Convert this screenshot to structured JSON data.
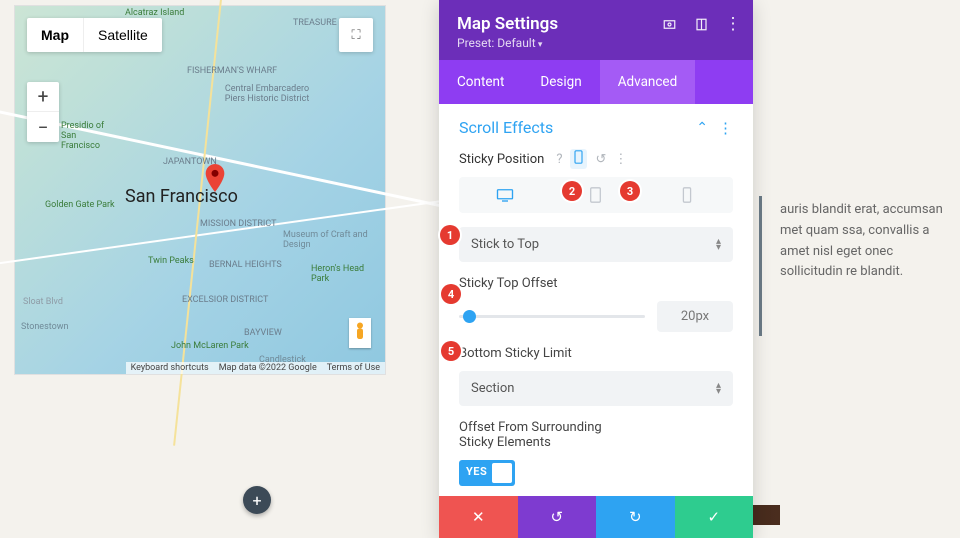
{
  "map": {
    "tab_map": "Map",
    "tab_satellite": "Satellite",
    "city_label": "San Francisco",
    "footer_shortcuts": "Keyboard shortcuts",
    "footer_attrib": "Map data ©2022 Google",
    "footer_terms": "Terms of Use",
    "places": {
      "alcatraz": "Alcatraz Island",
      "treasure": "TREASURE ISLAND",
      "fishwharf": "FISHERMAN'S WHARF",
      "embarc": "Central Embarcadero Piers Historic District",
      "presidio": "Presidio of San Francisco",
      "japantown": "JAPANTOWN",
      "gg": "Golden Gate Park",
      "mission": "MISSION DISTRICT",
      "craft": "Museum of Craft and Design",
      "twin": "Twin Peaks",
      "bernal": "BERNAL HEIGHTS",
      "heron": "Heron's Head Park",
      "excelsior": "EXCELSIOR DISTRICT",
      "bayview": "BAYVIEW",
      "sloat": "Sloat Blvd",
      "stonestown": "Stonestown",
      "mclaren": "John McLaren Park",
      "candle": "Candlestick"
    }
  },
  "settings": {
    "title": "Map Settings",
    "preset": "Preset: Default",
    "tabs": {
      "content": "Content",
      "design": "Design",
      "advanced": "Advanced"
    },
    "section": "Scroll Effects",
    "sticky_pos_label": "Sticky Position",
    "stick_to_top": "Stick to Top",
    "top_offset_label": "Sticky Top Offset",
    "top_offset_value": "20px",
    "bottom_limit_label": "Bottom Sticky Limit",
    "bottom_limit_value": "Section",
    "offset_elements_label": "Offset From Surrounding Sticky Elements",
    "toggle_yes": "YES"
  },
  "markers": {
    "m1": "1",
    "m2": "2",
    "m3": "3",
    "m4": "4",
    "m5": "5"
  },
  "lorem": "auris blandit erat, accumsan met quam ssa, convallis a amet nisl eget onec sollicitudin re blandit."
}
